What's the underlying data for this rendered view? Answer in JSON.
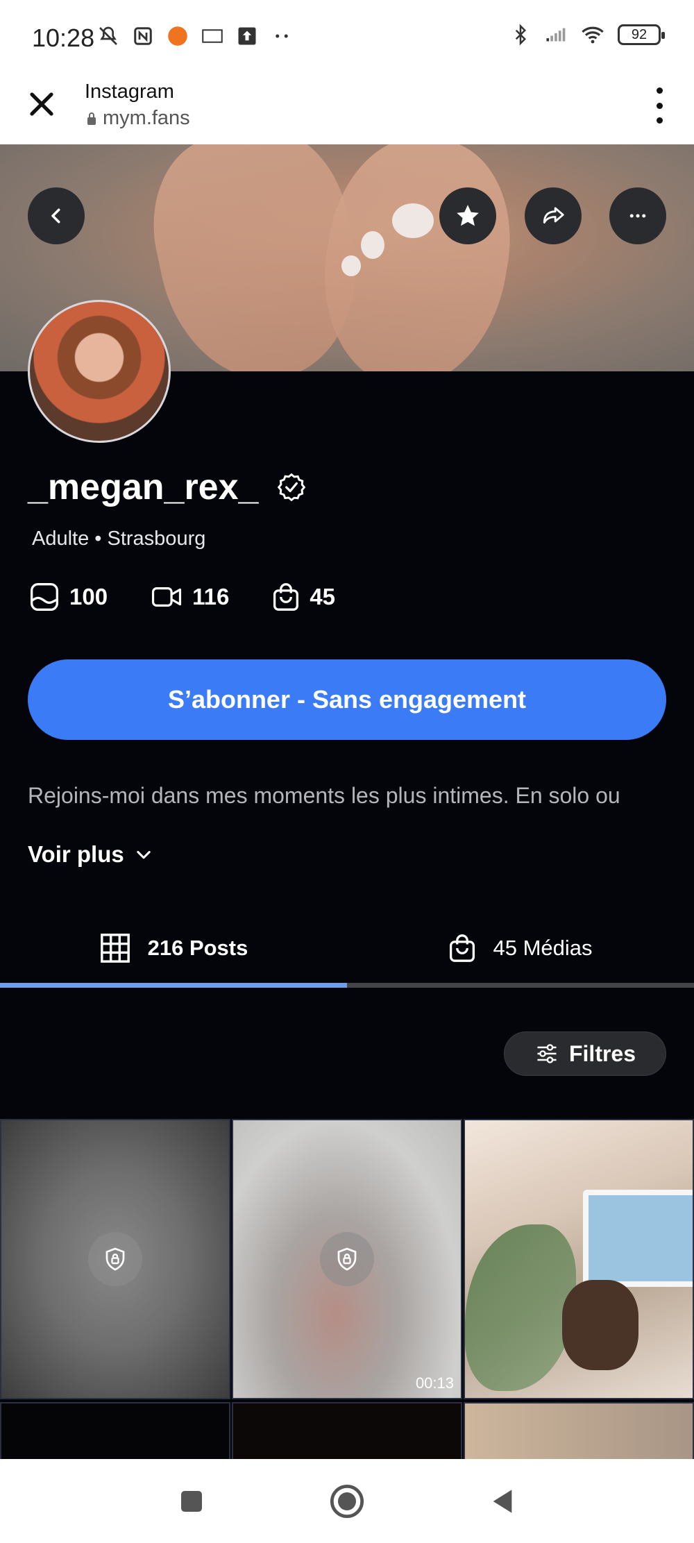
{
  "status_bar": {
    "time": "10:28",
    "battery": "92"
  },
  "browser": {
    "title": "Instagram",
    "url": "mym.fans"
  },
  "profile": {
    "username": "_megan_rex_",
    "subtitle": "Adulte • Strasbourg",
    "stats": {
      "photos": "100",
      "videos": "116",
      "medias": "45"
    },
    "subscribe_label": "S’abonner - Sans engagement",
    "bio": "Rejoins-moi dans mes moments les plus intimes. En solo ou",
    "voir_plus": "Voir plus"
  },
  "tabs": [
    {
      "label": "216 Posts",
      "active": true
    },
    {
      "label": "45 Médias",
      "active": false
    }
  ],
  "filters_label": "Filtres",
  "grid": {
    "duration": "00:13"
  },
  "colors": {
    "accent": "#3b7cf6",
    "background": "#04050a",
    "tab_indicator": "#6e9fe8"
  }
}
